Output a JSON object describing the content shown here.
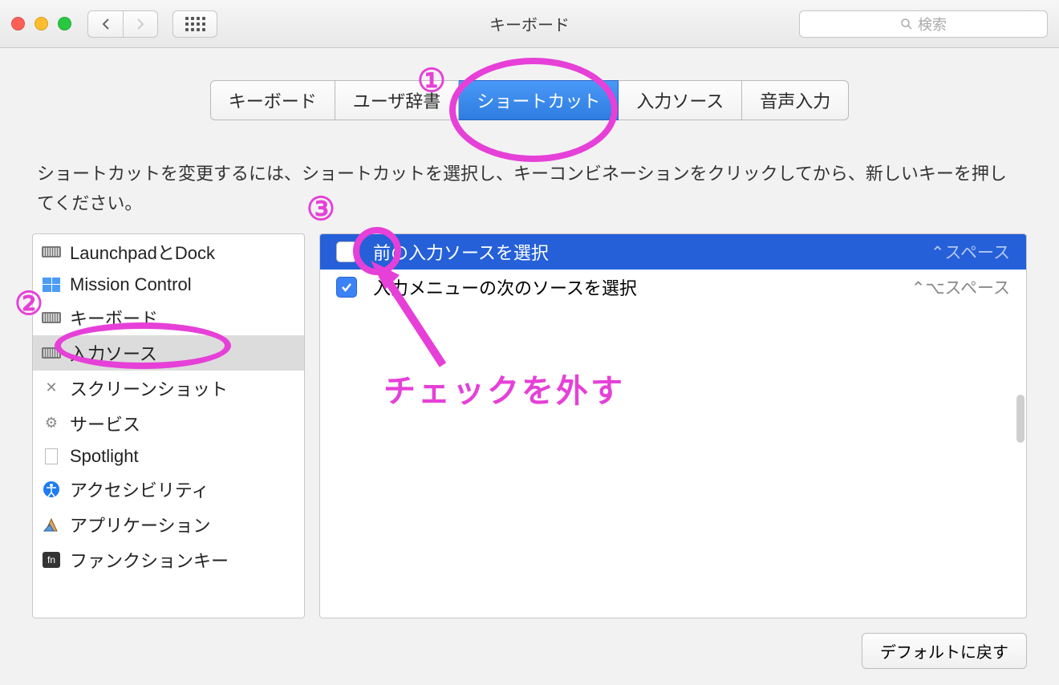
{
  "window": {
    "title": "キーボード",
    "search_placeholder": "検索"
  },
  "tabs": [
    {
      "label": "キーボード",
      "active": false
    },
    {
      "label": "ユーザ辞書",
      "active": false
    },
    {
      "label": "ショートカット",
      "active": true
    },
    {
      "label": "入力ソース",
      "active": false
    },
    {
      "label": "音声入力",
      "active": false
    }
  ],
  "instructions": "ショートカットを変更するには、ショートカットを選択し、キーコンビネーションをクリックしてから、新しいキーを押してください。",
  "sidebar": {
    "items": [
      {
        "label": "LaunchpadとDock",
        "icon": "keyboard-icon"
      },
      {
        "label": "Mission Control",
        "icon": "mission-control-icon"
      },
      {
        "label": "キーボード",
        "icon": "keyboard-icon"
      },
      {
        "label": "入力ソース",
        "icon": "keyboard-icon",
        "selected": true
      },
      {
        "label": "スクリーンショット",
        "icon": "screenshot-icon"
      },
      {
        "label": "サービス",
        "icon": "gear-icon"
      },
      {
        "label": "Spotlight",
        "icon": "document-icon"
      },
      {
        "label": "アクセシビリティ",
        "icon": "accessibility-icon"
      },
      {
        "label": "アプリケーション",
        "icon": "app-icon"
      },
      {
        "label": "ファンクションキー",
        "icon": "fn-icon"
      }
    ]
  },
  "shortcuts": [
    {
      "label": "前の入力ソースを選択",
      "key": "⌃スペース",
      "checked": false,
      "selected": true
    },
    {
      "label": "入力メニューの次のソースを選択",
      "key": "⌃⌥スペース",
      "checked": true,
      "selected": false
    }
  ],
  "buttons": {
    "restore_defaults": "デフォルトに戻す"
  },
  "annotations": {
    "n1": "①",
    "n2": "②",
    "n3": "③",
    "uncheck_text": "チェックを外す"
  }
}
